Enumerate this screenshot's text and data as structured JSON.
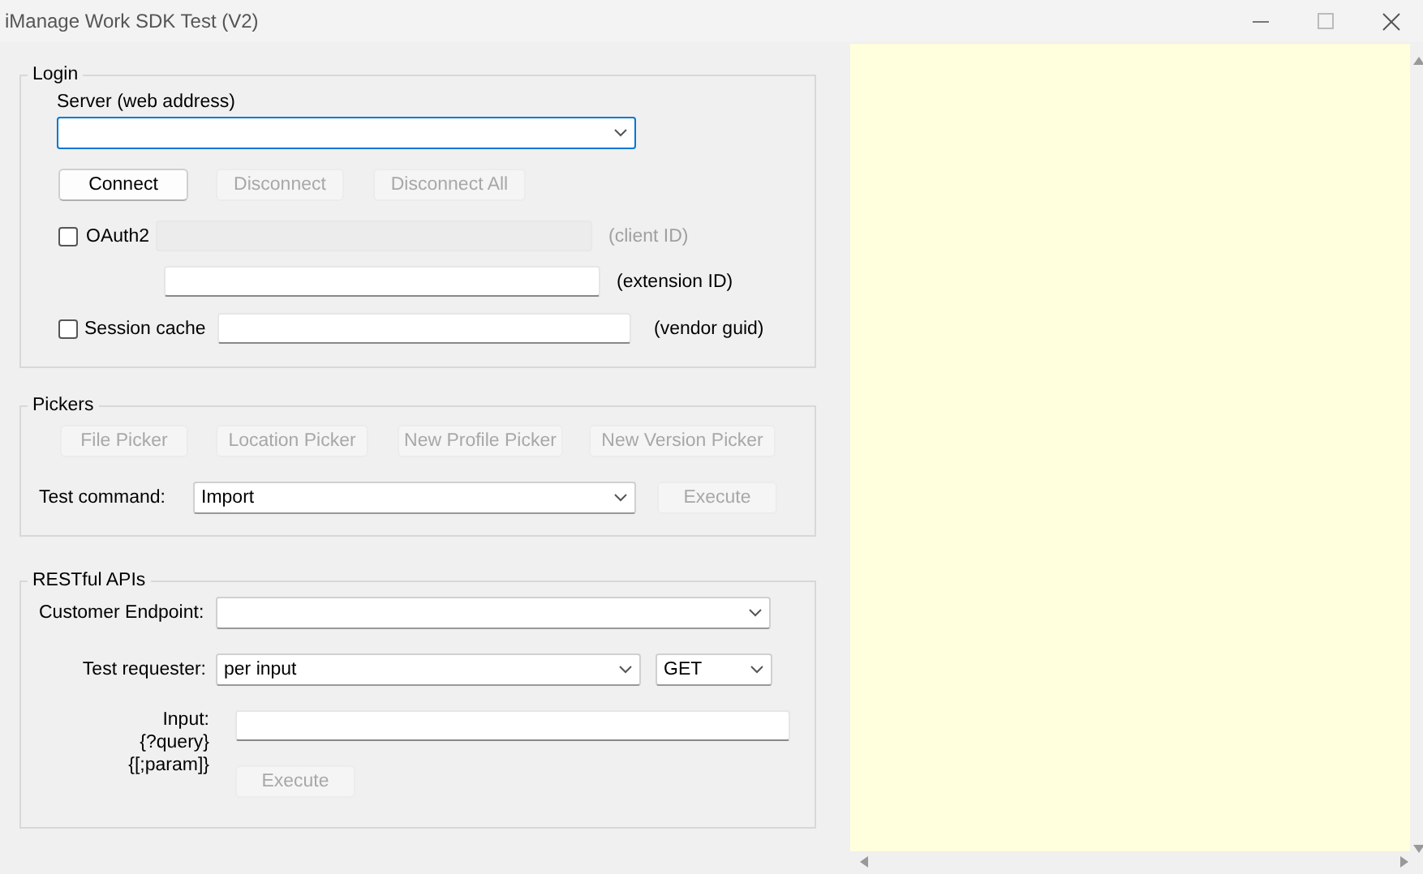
{
  "window": {
    "title": "iManage Work SDK Test (V2)"
  },
  "login": {
    "title": "Login",
    "server": {
      "label": "Server (web address)",
      "focused": true
    },
    "buttons": [
      {
        "label": "Connect",
        "disabled": false
      },
      {
        "label": "Disconnect",
        "disabled": true
      },
      {
        "label": "Disconnect All",
        "disabled": true
      }
    ],
    "oauth": {
      "label": "OAuth2",
      "checked": false
    },
    "client_id": {
      "hint": "(client ID)",
      "disabled": true
    },
    "extension_id": {
      "hint": "(extension ID)",
      "disabled": false
    },
    "session_cache": {
      "label": "Session cache",
      "checked": false
    },
    "vendor_guid": {
      "hint": "(vendor guid)",
      "disabled": false
    }
  },
  "pickers": {
    "title": "Pickers",
    "buttons": [
      {
        "label": "File Picker",
        "disabled": true
      },
      {
        "label": "Location Picker",
        "disabled": true
      },
      {
        "label": "New Profile Picker",
        "disabled": true
      },
      {
        "label": "New Version Picker",
        "disabled": true
      }
    ],
    "test_command": {
      "label": "Test command:",
      "value": "Import"
    },
    "execute": {
      "label": "Execute",
      "disabled": true
    }
  },
  "rest": {
    "title": "RESTful APIs",
    "customer_endpoint": {
      "label": "Customer Endpoint:"
    },
    "test_requester": {
      "label": "Test requester:",
      "value": "per input",
      "method": "GET"
    },
    "input": {
      "labels": [
        "Input:",
        "{?query}",
        "{[;param]}"
      ]
    },
    "execute": {
      "label": "Execute",
      "disabled": true
    }
  }
}
